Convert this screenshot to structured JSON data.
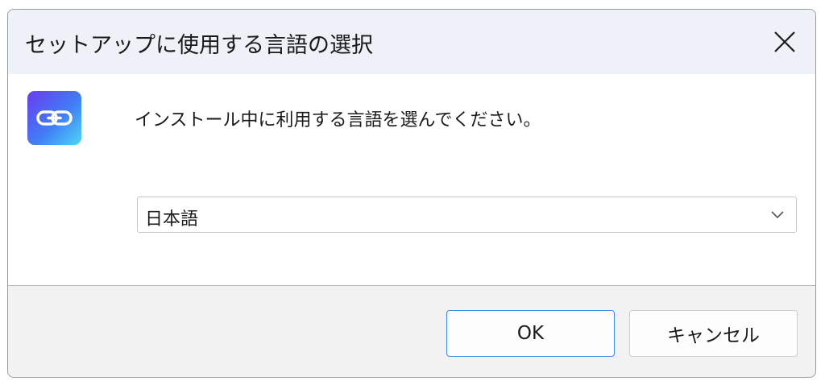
{
  "window": {
    "title": "セットアップに使用する言語の選択"
  },
  "content": {
    "prompt": "インストール中に利用する言語を選んでください。",
    "language_select": {
      "selected": "日本語"
    },
    "app_icon": {
      "icon": "link-icon",
      "gradient": [
        "#6a3cf0",
        "#3f7df5",
        "#4fd6f7"
      ]
    }
  },
  "buttons": {
    "ok_label": "OK",
    "cancel_label": "キャンセル"
  },
  "colors": {
    "title_bar_bg": "#eef2f8",
    "footer_bg": "#f2f2f2",
    "ok_border": "#3b8de6"
  }
}
